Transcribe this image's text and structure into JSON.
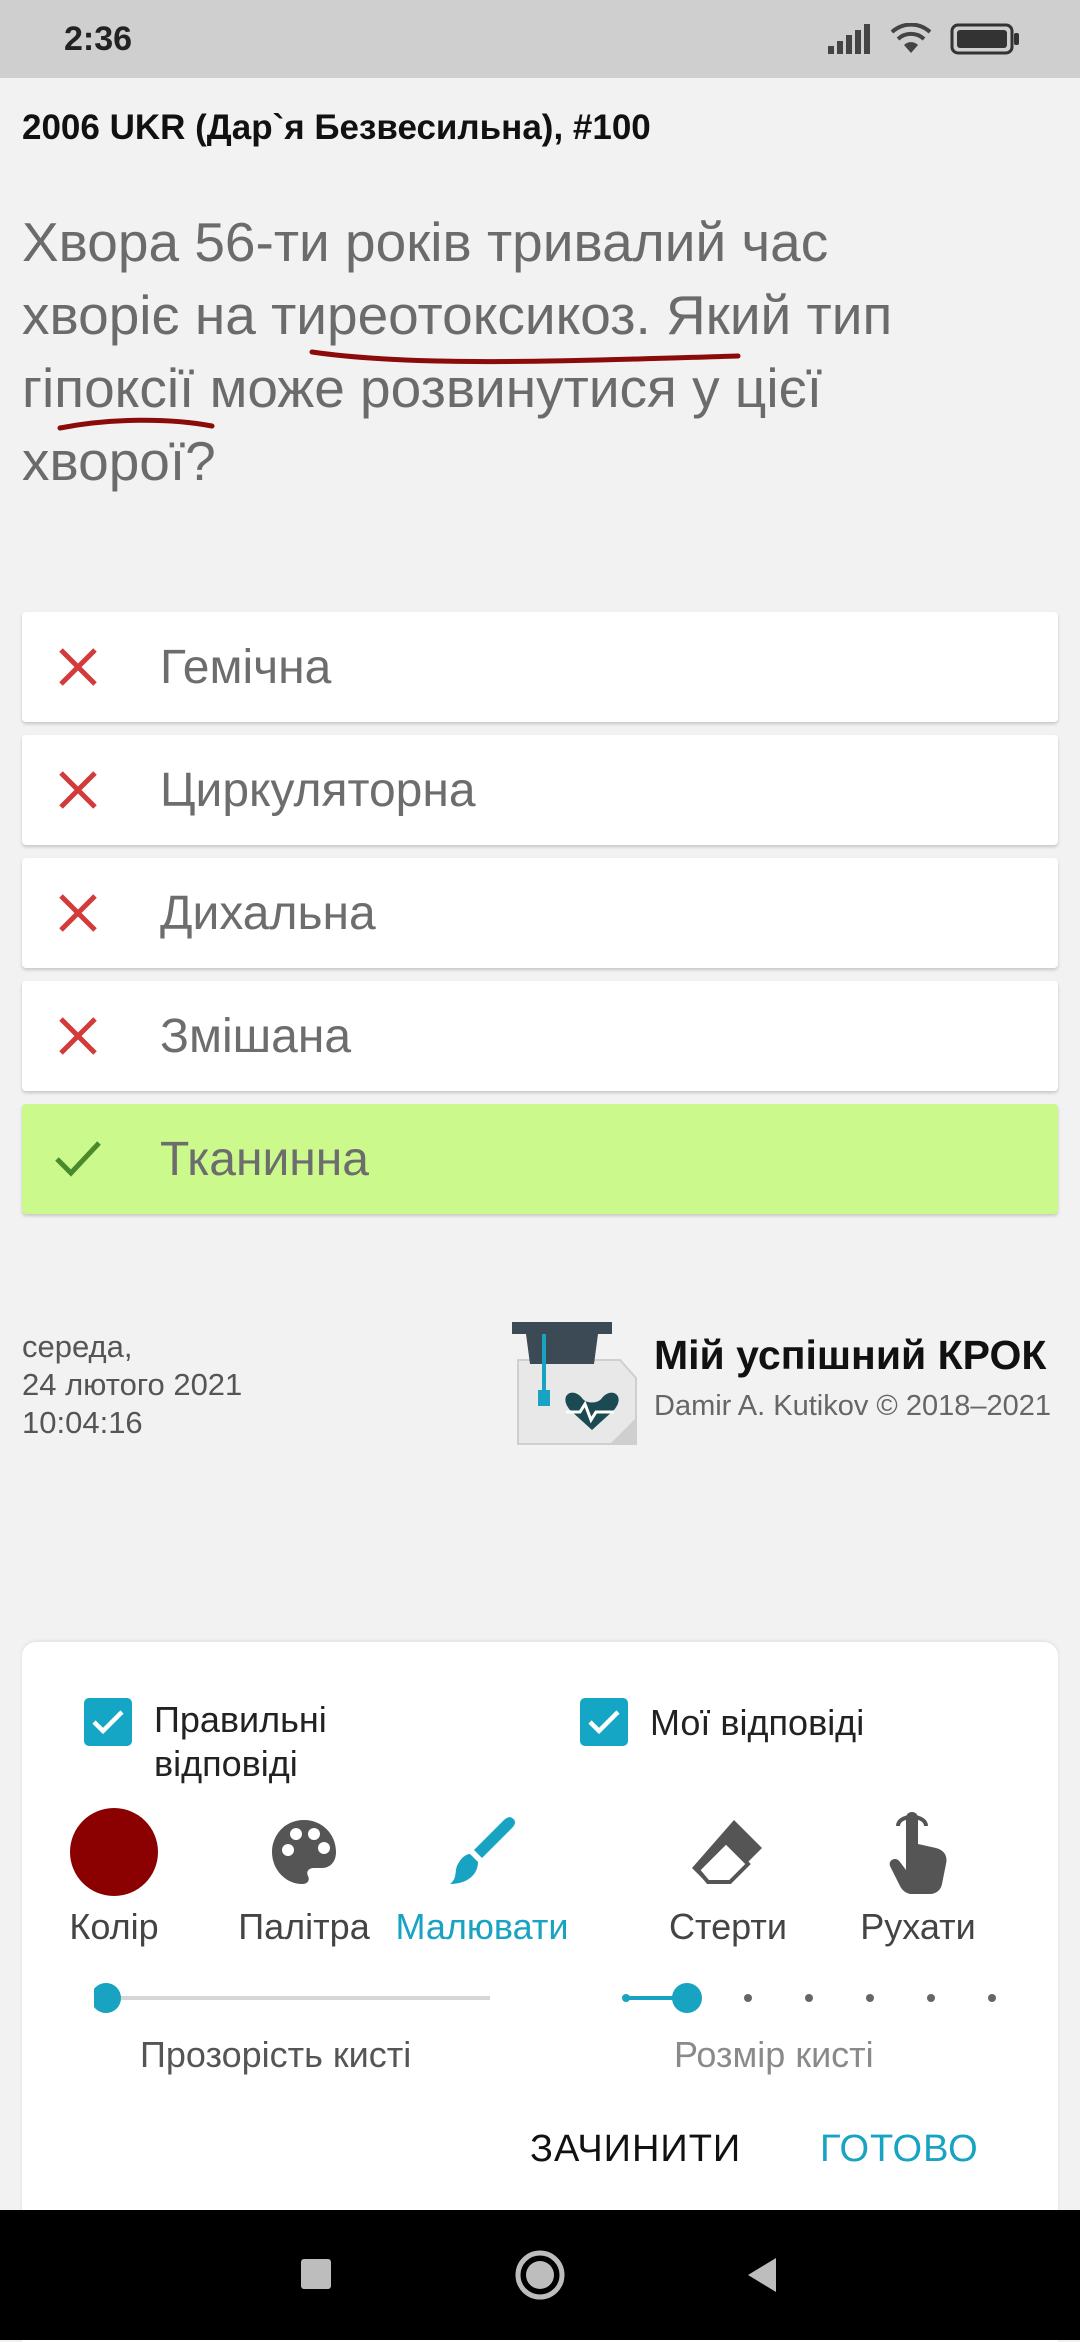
{
  "status_bar": {
    "time": "2:36"
  },
  "source": "2006 UKR (Дар`я Безвесильна), #100",
  "question": {
    "lines": [
      "Хвора 56-ти років тривалий час",
      "хворіє на тиреотоксикоз. Який тип",
      "гіпоксії може розвинутися у цієї",
      "хворої?"
    ]
  },
  "answers": [
    {
      "label": "Гемічна",
      "state": "wrong"
    },
    {
      "label": "Циркуляторна",
      "state": "wrong"
    },
    {
      "label": "Дихальна",
      "state": "wrong"
    },
    {
      "label": "Змішана",
      "state": "wrong"
    },
    {
      "label": "Тканинна",
      "state": "correct"
    }
  ],
  "datetime": "середа,\n24 лютого 2021\n10:04:16",
  "brand": {
    "title": "Мій успішний КРОК",
    "copyright": "Damir A. Kutikov © 2018–2021"
  },
  "panel": {
    "checkbox_correct": "Правильні\nвідповіді",
    "checkbox_mine": "Мої відповіді",
    "tools": {
      "color": "Колір",
      "palette": "Палітра",
      "draw": "Малювати",
      "erase": "Стерти",
      "move": "Рухати"
    },
    "opacity_label": "Прозорість кисті",
    "size_label": "Розмір кисті",
    "opacity_value": 0,
    "size_step": 2,
    "size_steps": 7,
    "close_button": "ЗАЧИНИТИ",
    "done_button": "ГОТОВО"
  },
  "colors": {
    "accent": "#17a3c1",
    "brush_color": "#8b0000",
    "wrong": "#d33a3a",
    "correct_bg": "#ccf98c"
  }
}
